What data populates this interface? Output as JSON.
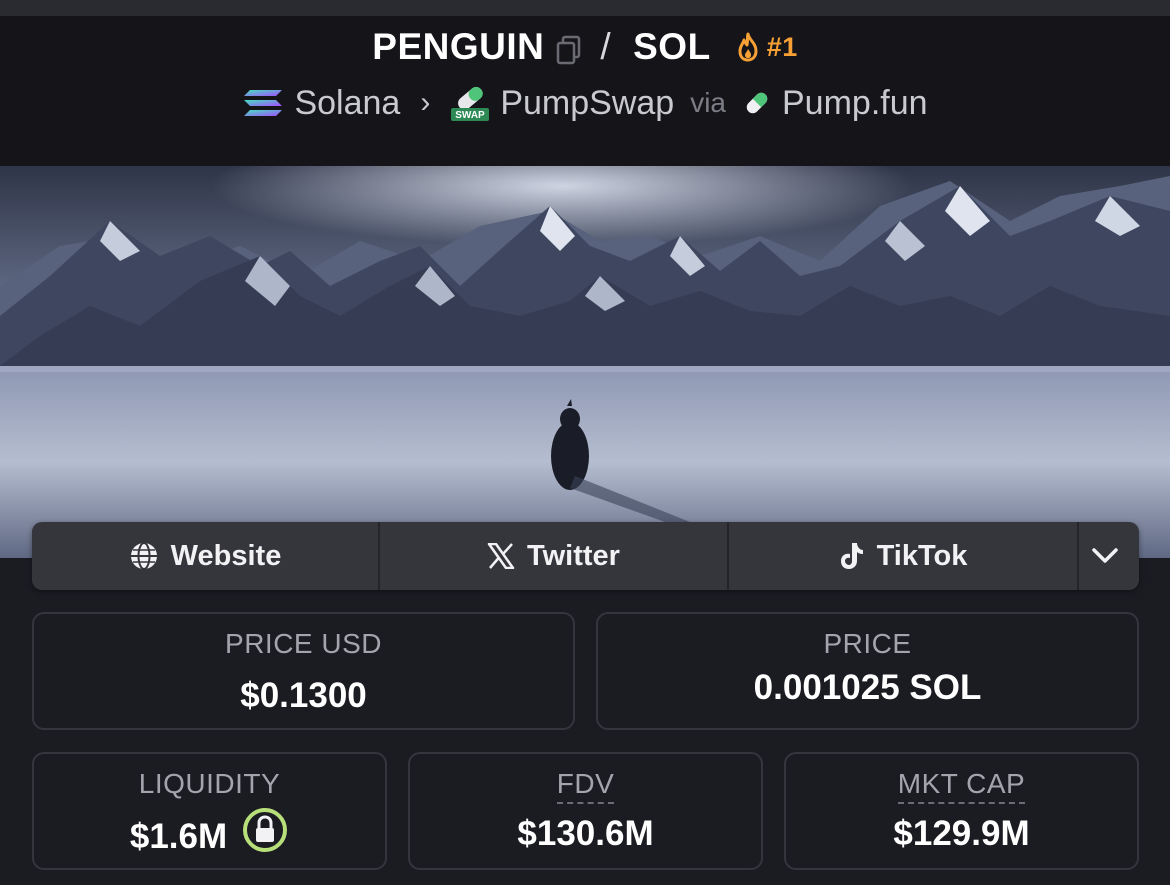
{
  "header": {
    "base_token": "PENGUIN",
    "separator": "/",
    "quote_token": "SOL",
    "rank": "#1",
    "chain": "Solana",
    "dex": "PumpSwap",
    "via_label": "via",
    "launchpad": "Pump.fun"
  },
  "links": {
    "website": "Website",
    "twitter": "Twitter",
    "tiktok": "TikTok"
  },
  "stats": {
    "price_usd_label": "PRICE USD",
    "price_usd_value": "$0.1300",
    "price_label": "PRICE",
    "price_value": "0.001025 SOL",
    "liquidity_label": "LIQUIDITY",
    "liquidity_value": "$1.6M",
    "fdv_label": "FDV",
    "fdv_value": "$130.6M",
    "mktcap_label": "MKT CAP",
    "mktcap_value": "$129.9M"
  },
  "colors": {
    "background": "#1b1b22",
    "rank_orange": "#f7a035",
    "lock_green": "#b8e07a"
  },
  "icons": [
    "copy-icon",
    "fire-icon",
    "solana-icon",
    "pumpswap-icon",
    "pill-icon",
    "globe-icon",
    "x-icon",
    "tiktok-icon",
    "chevron-down-icon",
    "lock-icon"
  ]
}
